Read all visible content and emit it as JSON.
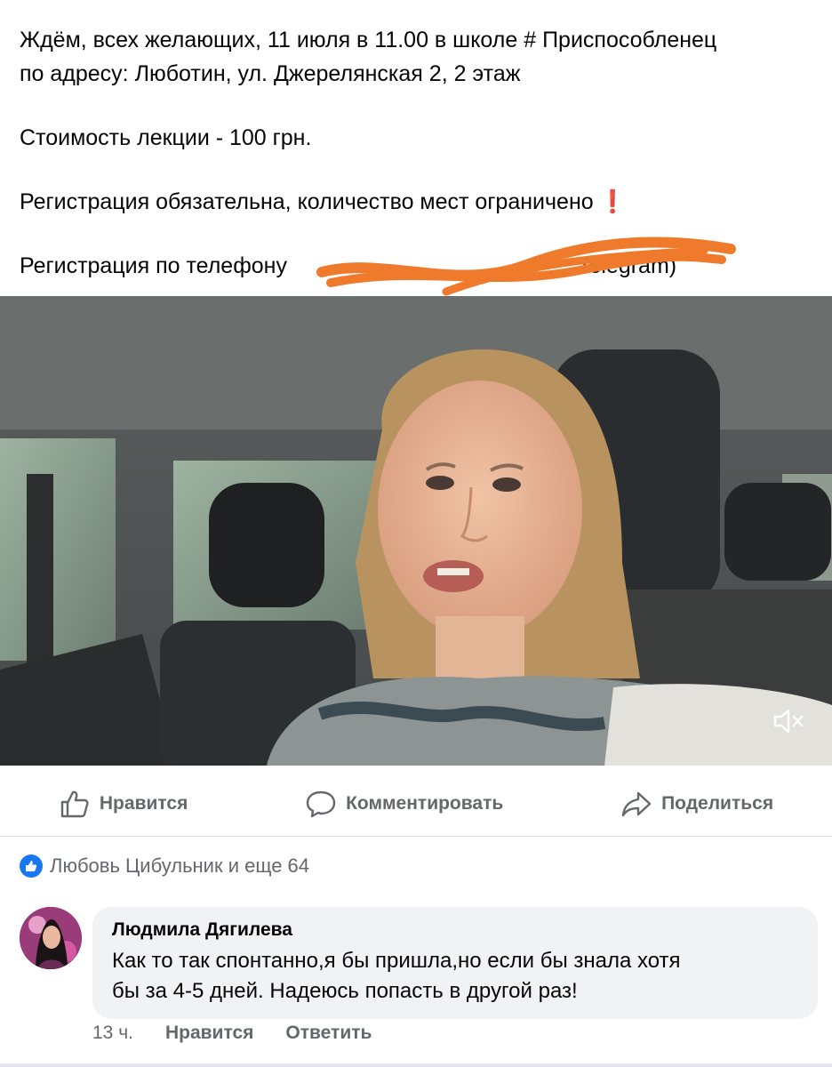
{
  "post": {
    "line1": "Ждём, всех желающих, 11 июля в 11.00 в школе # Приспособленец",
    "line2": "по адресу: Люботин, ул. Джерелянская 2, 2 этаж",
    "price": "Стоимость лекции - 100 грн.",
    "registration_required": "Регистрация обязательна, количество мест ограничено",
    "exclamation": "❗",
    "phone_prefix": "Регистрация по телефону",
    "phone_suffix": "Telegram)"
  },
  "actions": {
    "like_label": "Нравится",
    "comment_label": "Комментировать",
    "share_label": "Поделиться"
  },
  "reactions": {
    "summary": "Любовь Цибульник и еще 64"
  },
  "comment": {
    "author": "Людмила Дягилева",
    "text_line1": "Как то так спонтанно,я бы пришла,но если бы знала хотя",
    "text_line2": "бы за 4-5 дней. Надеюсь попасть в другой раз!",
    "time": "13 ч.",
    "like_label": "Нравится",
    "reply_label": "Ответить"
  },
  "colors": {
    "facebook_blue": "#1877f2",
    "secondary_text": "#65676b",
    "scribble_orange": "#f07a2c",
    "exclamation_red": "#e0242a"
  },
  "icons": {
    "like": "thumbs-up-icon",
    "comment": "speech-bubble-icon",
    "share": "share-arrow-icon",
    "mute": "speaker-muted-icon",
    "reaction": "like-badge-icon"
  }
}
